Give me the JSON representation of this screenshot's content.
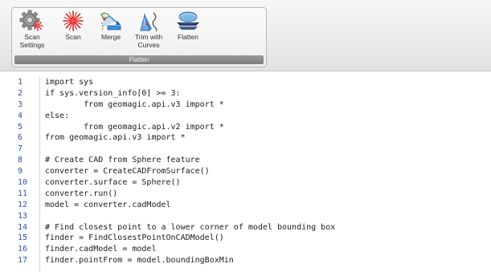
{
  "ribbon": {
    "group_caption": "Flatten",
    "buttons": [
      {
        "id": "scan-settings",
        "label": "Scan\nSettings",
        "icon": "scan-settings-icon"
      },
      {
        "id": "scan",
        "label": "Scan",
        "icon": "scan-icon"
      },
      {
        "id": "merge",
        "label": "Merge",
        "icon": "merge-icon"
      },
      {
        "id": "trim-with-curves",
        "label": "Trim with\nCurves",
        "icon": "trim-with-curves-icon"
      },
      {
        "id": "flatten",
        "label": "Flatten",
        "icon": "flatten-icon"
      }
    ]
  },
  "editor": {
    "line_numbers": [
      "1",
      "2",
      "3",
      "4",
      "5",
      "6",
      "7",
      "8",
      "9",
      "10",
      "11",
      "12",
      "13",
      "14",
      "15",
      "16",
      "17"
    ],
    "lines": [
      "import sys",
      "if sys.version_info[0] >= 3:",
      "        from geomagic.api.v3 import *",
      "else:",
      "        from geomagic.api.v2 import *",
      "from geomagic.api.v3 import *",
      "",
      "# Create CAD from Sphere feature",
      "converter = CreateCADFromSurface()",
      "converter.surface = Sphere()",
      "converter.run()",
      "model = converter.cadModel",
      "",
      "# Find closest point to a lower corner of model bounding box",
      "finder = FindClosestPointOnCADModel()",
      "finder.cadModel = model",
      "finder.pointFrom = model.boundingBoxMin"
    ]
  },
  "colors": {
    "line_number": "#2d53a8",
    "code_text": "#1b1b1b",
    "scan_red": "#e02020",
    "merge_blue": "#3a8fd8",
    "flatten_navy": "#243a6e"
  }
}
